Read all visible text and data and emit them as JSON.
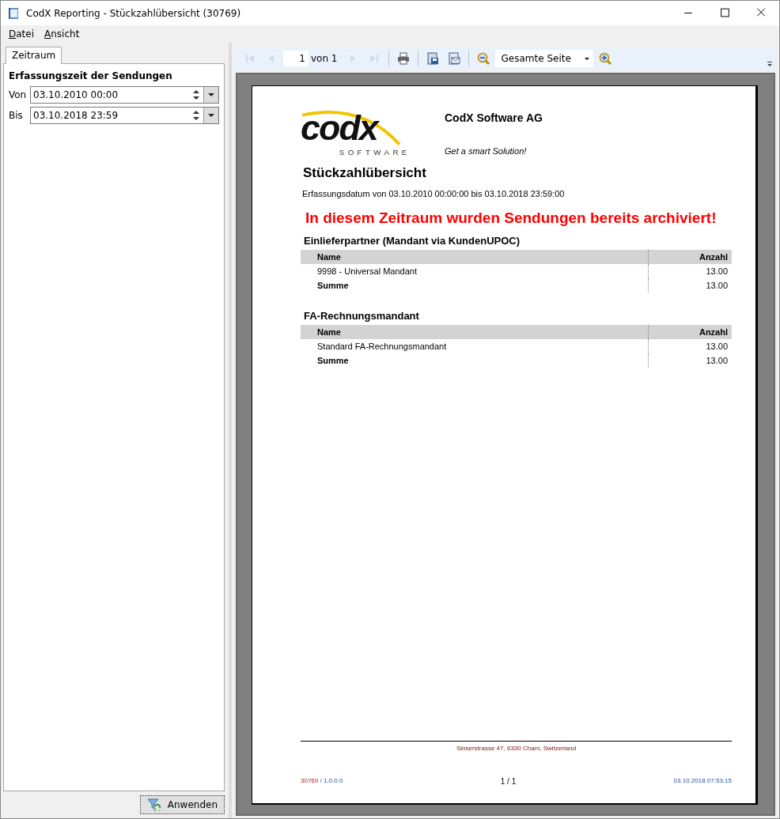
{
  "window": {
    "title": "CodX Reporting - Stückzahlübersicht (30769)"
  },
  "menu": [
    {
      "label": "Datei"
    },
    {
      "label": "Ansicht"
    }
  ],
  "tabs": [
    {
      "label": "Zeitraum",
      "selected": true
    }
  ],
  "filter": {
    "heading": "Erfassungszeit der Sendungen",
    "fields": [
      {
        "label": "Von",
        "value": "03.10.2010 00:00"
      },
      {
        "label": "Bis",
        "value": "03.10.2018 23:59"
      }
    ],
    "apply_button": "Anwenden"
  },
  "toolbar": {
    "items": [
      {
        "kind": "first",
        "disabled": true
      },
      {
        "kind": "prev",
        "disabled": true
      },
      {
        "kind": "page",
        "value": "1",
        "total": "von 1"
      },
      {
        "kind": "next",
        "disabled": true
      },
      {
        "kind": "last",
        "disabled": true
      },
      {
        "kind": "sep"
      },
      {
        "kind": "print",
        "disabled": false
      },
      {
        "kind": "sep"
      },
      {
        "kind": "save",
        "disabled": false
      },
      {
        "kind": "email",
        "disabled": false
      },
      {
        "kind": "sep"
      },
      {
        "kind": "zoom-out",
        "disabled": false
      },
      {
        "kind": "zoom",
        "value": "Gesamte Seite"
      },
      {
        "kind": "zoom-in",
        "disabled": false
      }
    ]
  },
  "report": {
    "logo": {
      "word": "codx",
      "subtitle": "SOFTWARE"
    },
    "company": "CodX Software AG",
    "slogan": "Get a smart Solution!",
    "title": "Stückzahlübersicht",
    "date_range": "Erfassungsdatum von 03.10.2010 00:00:00 bis 03.10.2018 23:59:00",
    "warning": "In diesem Zeitraum wurden Sendungen bereits archiviert!",
    "sections": [
      {
        "heading": "Einlieferpartner (Mandant via KundenUPOC)",
        "columns": [
          "Name",
          "Anzahl"
        ],
        "rows": [
          {
            "kind": "item",
            "name": "9998 - Universal Mandant",
            "count": "13.00"
          },
          {
            "kind": "total",
            "name": "Summe",
            "count": "13.00"
          }
        ]
      },
      {
        "heading": "FA-Rechnungsmandant",
        "columns": [
          "Name",
          "Anzahl"
        ],
        "rows": [
          {
            "kind": "item",
            "name": "Standard FA-Rechnungsmandant",
            "count": "13.00"
          },
          {
            "kind": "total",
            "name": "Summe",
            "count": "13.00"
          }
        ]
      }
    ],
    "footer": {
      "address": "Sinserstrasse 47, 6330 Cham, Switzerland",
      "report_id": "30769",
      "version": "/ 1.0.0.0",
      "page": "1 / 1",
      "printed": "03.10.2018 07:53:15"
    }
  }
}
